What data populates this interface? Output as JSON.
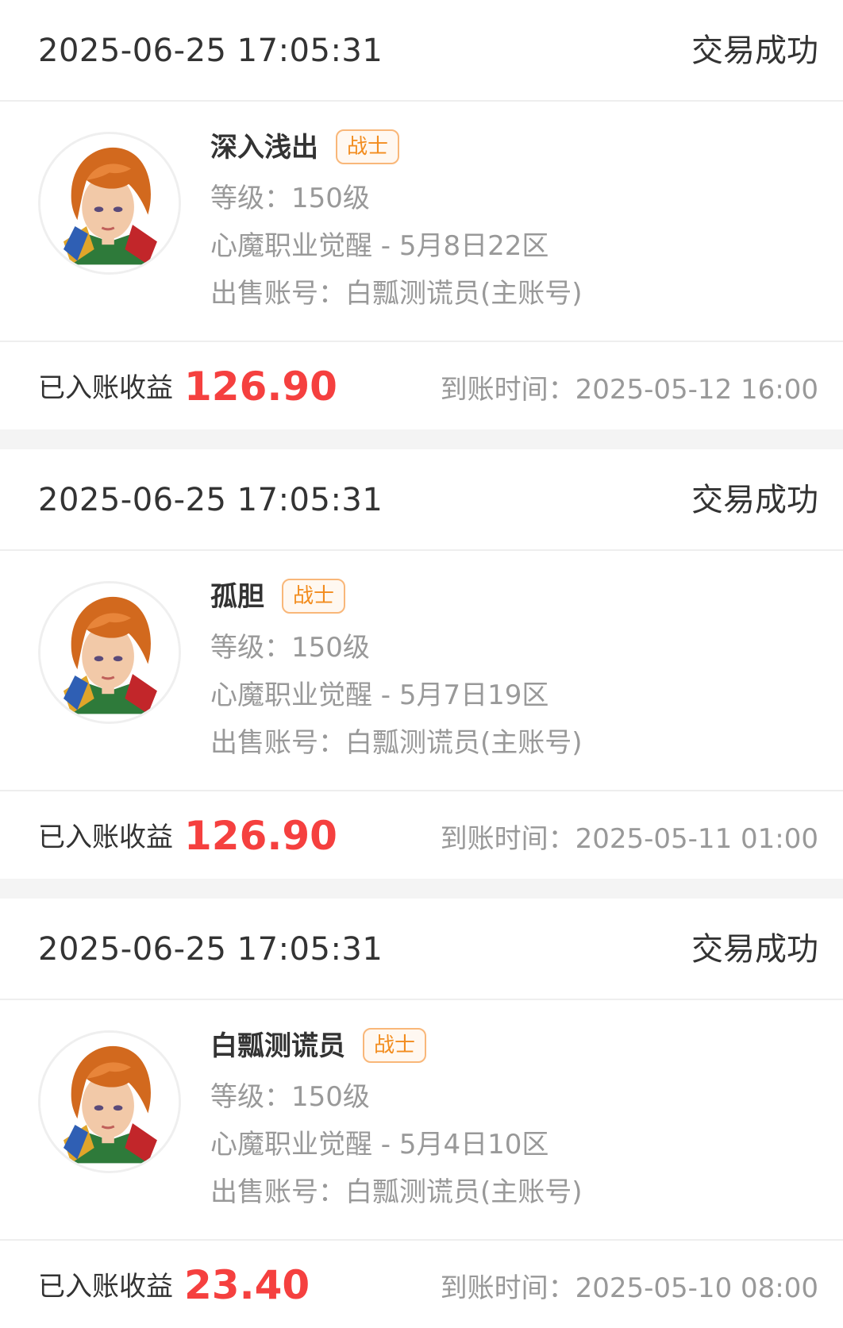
{
  "orders": [
    {
      "time": "2025-06-25 17:05:31",
      "status": "交易成功",
      "name": "深入浅出",
      "class_tag": "战士",
      "level": "等级：150级",
      "server": "心魔职业觉醒 - 5月8日22区",
      "account": "出售账号：白瓢测谎员(主账号)",
      "income_label": "已入账收益",
      "income_amount": "126.90",
      "arrival": "到账时间：2025-05-12 16:00"
    },
    {
      "time": "2025-06-25 17:05:31",
      "status": "交易成功",
      "name": "孤胆",
      "class_tag": "战士",
      "level": "等级：150级",
      "server": "心魔职业觉醒 - 5月7日19区",
      "account": "出售账号：白瓢测谎员(主账号)",
      "income_label": "已入账收益",
      "income_amount": "126.90",
      "arrival": "到账时间：2025-05-11 01:00"
    },
    {
      "time": "2025-06-25 17:05:31",
      "status": "交易成功",
      "name": "白瓢测谎员",
      "class_tag": "战士",
      "level": "等级：150级",
      "server": "心魔职业觉醒 - 5月4日10区",
      "account": "出售账号：白瓢测谎员(主账号)",
      "income_label": "已入账收益",
      "income_amount": "23.40",
      "arrival": "到账时间：2025-05-10 08:00"
    }
  ],
  "colors": {
    "accent_red": "#f5403f",
    "tag_orange": "#f28c1e",
    "tag_border": "#f9b779",
    "text_primary": "#333333",
    "text_secondary": "#999999",
    "divider": "#eeeeee",
    "gap_bg": "#f4f4f4"
  },
  "icons": {
    "avatar": "warrior-portrait-icon"
  }
}
